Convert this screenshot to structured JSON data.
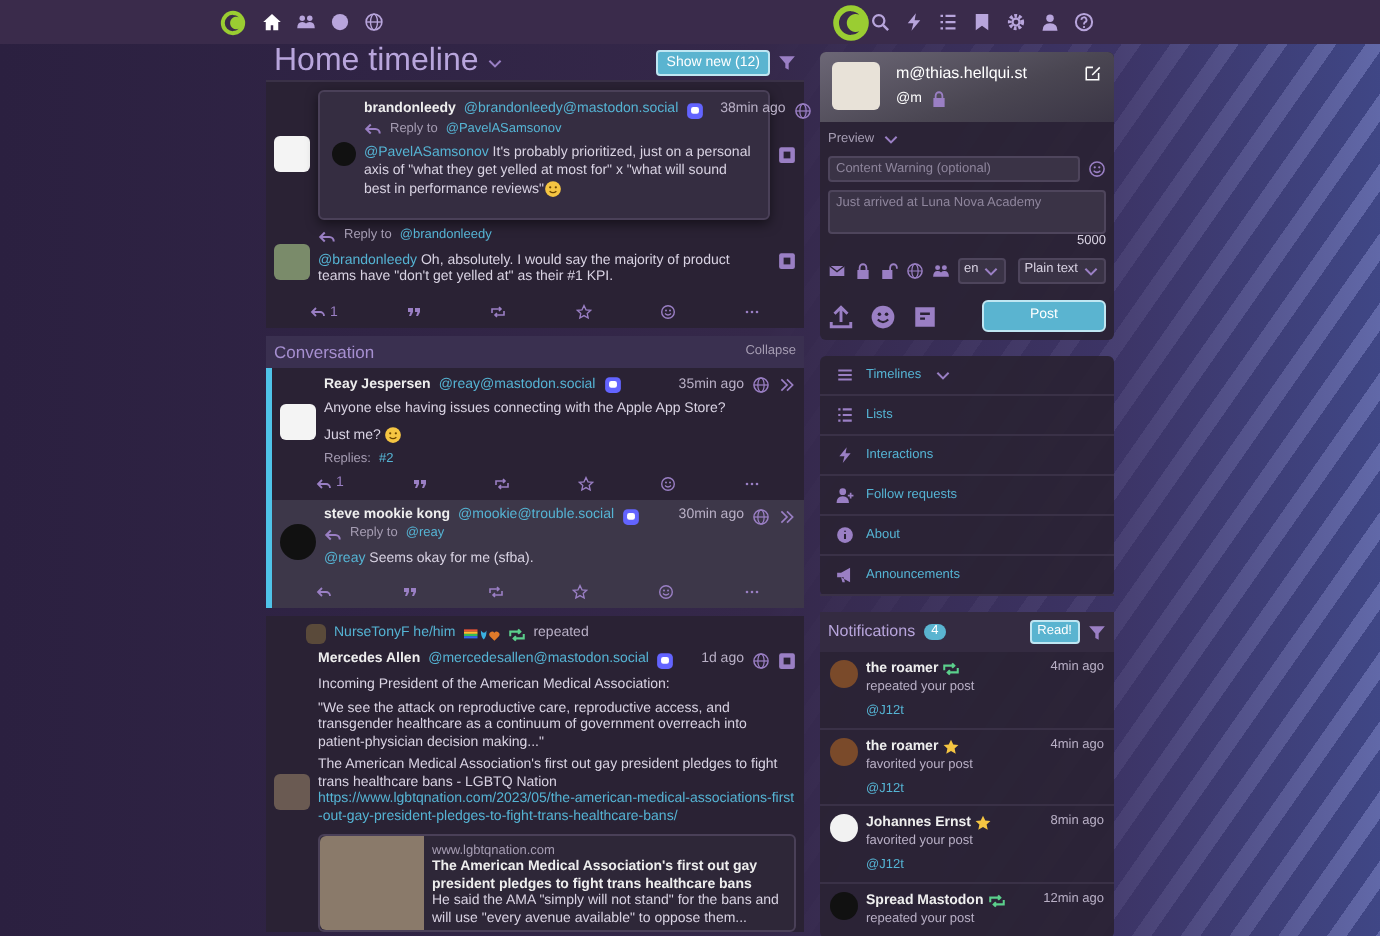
{
  "top_bar": {
    "left_nav": [
      {
        "selected": true
      },
      {
        "selected": false
      },
      {
        "selected": false
      },
      {
        "selected": false
      }
    ],
    "right_nav": [
      {
        "selected": false
      },
      {
        "selected": false
      },
      {
        "selected": false
      },
      {
        "selected": false
      },
      {
        "selected": false
      },
      {
        "selected": false
      },
      {
        "selected": false
      }
    ]
  },
  "timeline": {
    "title": "Home timeline",
    "show_new": "Show new (12)",
    "thread": {
      "popover": {
        "author": "brandonleedy",
        "handle": "@brandonleedy@mastodon.social",
        "time": "38min ago",
        "reply_label": "Reply to",
        "reply_to": "@PavelASamsonov",
        "mention": "@PavelASamsonov",
        "text": "It's probably prioritized, just on a personal axis of \"what they get yelled at most for\" x \"what will sound best in performance reviews\"",
        "ends_with_emoji": true
      },
      "reply": {
        "reply_label": "Reply to",
        "reply_to": "@brandonleedy",
        "mention": "@brandonleedy",
        "text": "Oh, absolutely. I would say the majority of product teams have \"don't get yelled at\" as their #1 KPI.",
        "reply_count": "1"
      }
    },
    "conversation": {
      "title": "Conversation",
      "collapse": "Collapse",
      "posts": [
        {
          "selected": false,
          "author": "Reay Jespersen",
          "handle": "@reay@mastodon.social",
          "time": "35min ago",
          "paragraphs": [
            "Anyone else having issues connecting with the Apple App Store?",
            "Just me?"
          ],
          "ends_with_emoji": true,
          "replies_label": "Replies:",
          "replies_link": "#2",
          "reply_count": "1"
        },
        {
          "selected": true,
          "author": "steve mookie kong",
          "handle": "@mookie@trouble.social",
          "time": "30min ago",
          "reply_label": "Reply to",
          "reply_to": "@reay",
          "mention": "@reay",
          "text": "Seems okay for me (sfba)."
        }
      ]
    },
    "boost": {
      "booster": "NurseTonyF he/him",
      "action": "repeated",
      "author": "Mercedes Allen",
      "handle": "@mercedesallen@mastodon.social",
      "time": "1d ago",
      "paragraphs": [
        "Incoming President of the American Medical Association:",
        "\"We see the attack on reproductive care, reproductive access, and transgender healthcare as a continuum of government overreach into patient-physician decision making...\"",
        "The American Medical Association's first out gay president pledges to fight trans healthcare bans - LGBTQ Nation"
      ],
      "link": "https://www.lgbtqnation.com/2023/05/the-american-medical-associations-first-out-gay-president-pledges-to-fight-trans-healthcare-bans/",
      "card": {
        "site": "www.lgbtqnation.com",
        "title": "The American Medical Association's first out gay president pledges to fight trans healthcare bans",
        "description": "He said the AMA \"simply will not stand\" for the bans and will use \"every avenue available\" to oppose them..."
      }
    }
  },
  "compose": {
    "display_name": "m@thias.hellqui.st",
    "handle": "@m",
    "preview": "Preview",
    "cw_placeholder": "Content Warning (optional)",
    "text_placeholder": "Just arrived at Luna Nova Academy",
    "counter": "5000",
    "language": "en",
    "format": "Plain text",
    "post": "Post"
  },
  "menu": {
    "items": [
      {
        "label": "Timelines",
        "dropdown": true
      },
      {
        "label": "Lists"
      },
      {
        "label": "Interactions"
      },
      {
        "label": "Follow requests"
      },
      {
        "label": "About"
      },
      {
        "label": "Announcements"
      }
    ]
  },
  "notifications": {
    "title": "Notifications",
    "count": "4",
    "read_button": "Read!",
    "items": [
      {
        "author": "the roamer",
        "kind": "repeat",
        "action": "repeated your post",
        "time": "4min ago",
        "target": "@J12t"
      },
      {
        "author": "the roamer",
        "kind": "favorite",
        "action": "favorited your post",
        "time": "4min ago",
        "target": "@J12t"
      },
      {
        "author": "Johannes Ernst",
        "kind": "favorite",
        "action": "favorited your post",
        "time": "8min ago",
        "target": "@J12t"
      },
      {
        "author": "Spread Mastodon",
        "kind": "repeat",
        "action": "repeated your post",
        "time": "12min ago"
      }
    ]
  }
}
